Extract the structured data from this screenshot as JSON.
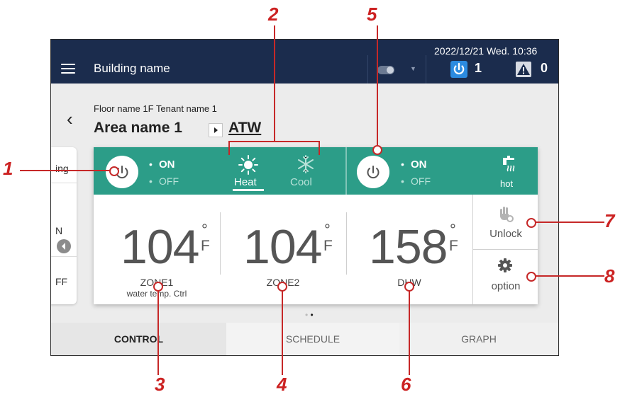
{
  "header": {
    "building": "Building name",
    "datetime": "2022/12/21 Wed. 10:36",
    "power_count": "1",
    "alert_count": "0"
  },
  "nav": {
    "floor": "Floor name 1F Tenant name 1",
    "area": "Area name 1",
    "atw": "ATW"
  },
  "left_card": {
    "frag1": "ing",
    "frag2": "N",
    "frag3": "FF"
  },
  "unit1": {
    "on": "ON",
    "off": "OFF",
    "heat": "Heat",
    "cool": "Cool"
  },
  "unit2": {
    "on": "ON",
    "off": "OFF",
    "hot": "hot"
  },
  "temps": [
    {
      "value": "104",
      "unit": "F",
      "label": "ZONE1",
      "sub": "water temp. Ctrl"
    },
    {
      "value": "104",
      "unit": "F",
      "label": "ZONE2"
    },
    {
      "value": "158",
      "unit": "F",
      "label": "DHW"
    }
  ],
  "buttons": {
    "unlock": "Unlock",
    "option": "option"
  },
  "tabs": [
    "CONTROL",
    "SCHEDULE",
    "GRAPH"
  ],
  "callouts": [
    "1",
    "2",
    "3",
    "4",
    "5",
    "6",
    "7",
    "8"
  ],
  "colors": {
    "header": "#1b2c4d",
    "teal": "#2c9d88",
    "callout": "#cc2222",
    "power_badge": "#2c8be0"
  }
}
